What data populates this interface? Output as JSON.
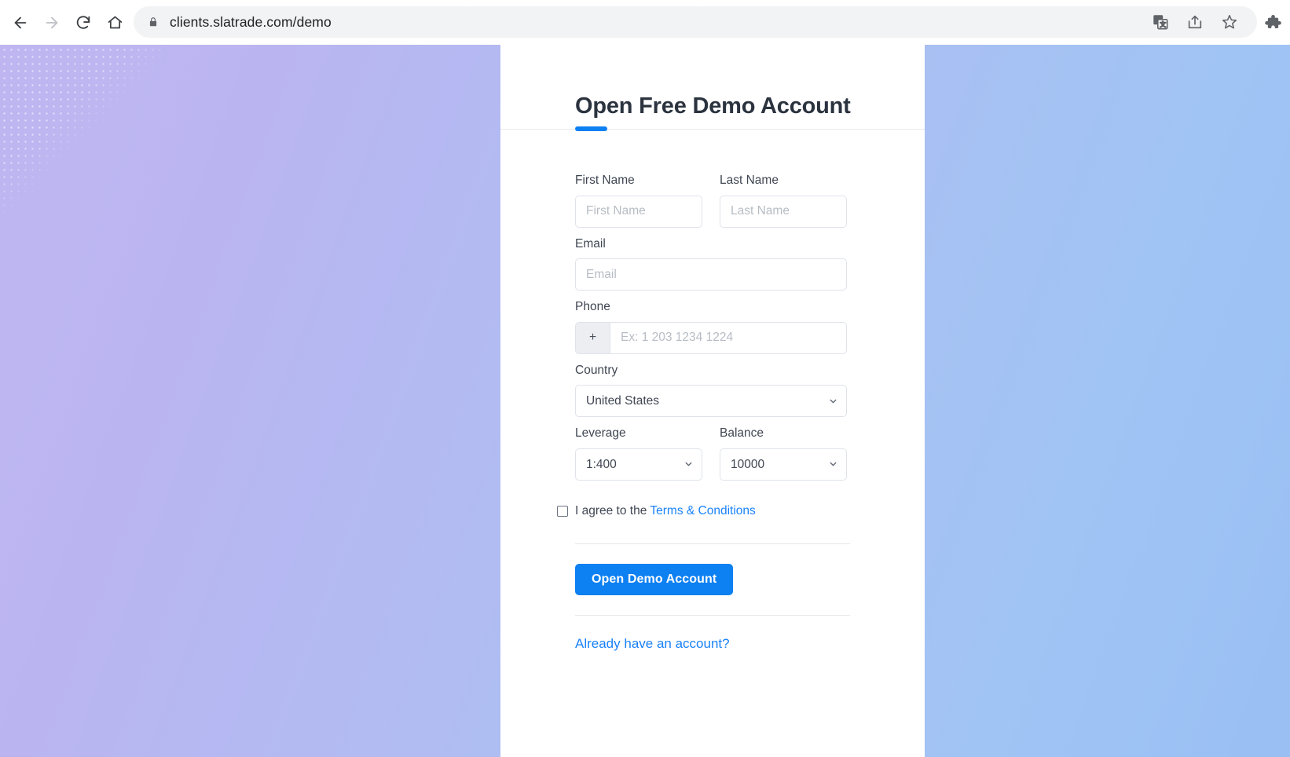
{
  "browser": {
    "url": "clients.slatrade.com/demo",
    "nav": {
      "back": "back-arrow",
      "forward": "forward-arrow",
      "reload": "reload",
      "home": "home"
    },
    "omnibox_icons": [
      "lock-icon",
      "translate-icon",
      "share-icon",
      "bookmark-star-icon"
    ],
    "extensions_icon": "puzzle-piece-icon"
  },
  "card": {
    "title": "Open Free Demo Account",
    "accent_color": "#0d80f2"
  },
  "form": {
    "first_name": {
      "label": "First Name",
      "placeholder": "First Name",
      "value": ""
    },
    "last_name": {
      "label": "Last Name",
      "placeholder": "Last Name",
      "value": ""
    },
    "email": {
      "label": "Email",
      "placeholder": "Email",
      "value": ""
    },
    "phone": {
      "label": "Phone",
      "prefix": "+",
      "placeholder": "Ex: 1 203 1234 1224",
      "value": ""
    },
    "country": {
      "label": "Country",
      "value": "United States",
      "options": [
        "United States"
      ]
    },
    "leverage": {
      "label": "Leverage",
      "value": "1:400",
      "options": [
        "1:400"
      ]
    },
    "balance": {
      "label": "Balance",
      "value": "10000",
      "options": [
        "10000"
      ]
    },
    "terms": {
      "text": "I agree to the ",
      "link": "Terms & Conditions",
      "checked": false
    },
    "submit_label": "Open Demo Account",
    "login_link": "Already have an account?"
  },
  "colors": {
    "brand_blue": "#0d80f2",
    "link_blue": "#1a82f7",
    "bg_gradient_start": "#b9aff0",
    "bg_gradient_end": "#8fb9f2"
  }
}
